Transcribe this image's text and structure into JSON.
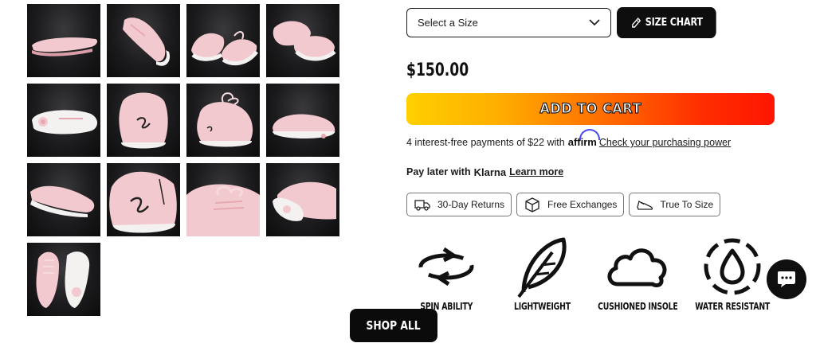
{
  "gallery": {
    "thumbnails": [
      {
        "view": "insole",
        "icon": "sole-insole-image"
      },
      {
        "view": "side-angled",
        "icon": "shoe-side-image"
      },
      {
        "view": "pair-front",
        "icon": "shoe-pair-image"
      },
      {
        "view": "pair-top",
        "icon": "shoe-pair-image"
      },
      {
        "view": "bottom-sole",
        "icon": "sole-bottom-image"
      },
      {
        "view": "heel-back",
        "icon": "shoe-heel-image"
      },
      {
        "view": "heel-side",
        "icon": "shoe-heel-image"
      },
      {
        "view": "side-sole",
        "icon": "shoe-side-image"
      },
      {
        "view": "side-low",
        "icon": "shoe-side-image"
      },
      {
        "view": "heel-close",
        "icon": "shoe-heel-image"
      },
      {
        "view": "laces-close",
        "icon": "shoe-laces-image"
      },
      {
        "view": "toe-sole",
        "icon": "sole-bottom-image"
      },
      {
        "view": "pair-overhead",
        "icon": "shoe-pair-image"
      }
    ]
  },
  "product": {
    "size_select": {
      "placeholder": "Select a Size"
    },
    "size_chart_label": "SIZE CHART",
    "price": "$150.00",
    "add_to_cart_label": "ADD TO CART",
    "affirm": {
      "prefix": "4 interest-free payments of $22 with",
      "brand": "affirm",
      "link": "Check your purchasing power"
    },
    "klarna": {
      "prefix": "Pay later with",
      "brand": "Klarna",
      "link": "Learn more"
    },
    "badges": [
      {
        "label": "30-Day Returns",
        "icon": "delivery-truck-icon"
      },
      {
        "label": "Free Exchanges",
        "icon": "package-box-icon"
      },
      {
        "label": "True To Size",
        "icon": "sneaker-icon"
      }
    ]
  },
  "features": [
    {
      "label": "SPIN ABILITY",
      "icon": "spin-arrows-icon"
    },
    {
      "label": "LIGHTWEIGHT",
      "icon": "feather-icon"
    },
    {
      "label": "CUSHIONED INSOLE",
      "icon": "cloud-icon"
    },
    {
      "label": "WATER RESISTANT",
      "icon": "water-drop-icon"
    }
  ],
  "shop_all_label": "SHOP ALL",
  "colors": {
    "shoe_pink": "#f2c9cf",
    "sole_white": "#f4f1f1",
    "photo_bg": "#1b1b1d",
    "cart_gradient_start": "#ffd000",
    "cart_gradient_end": "#ff1500",
    "affirm_blue": "#4a4af4"
  }
}
